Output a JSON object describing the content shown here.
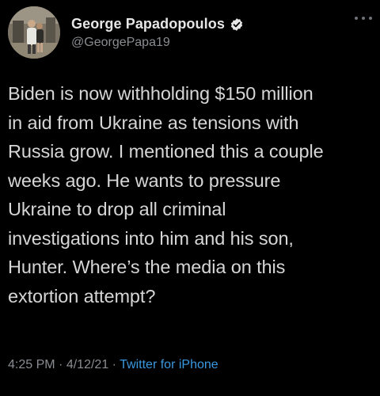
{
  "tweet": {
    "author": {
      "display_name": "George Papadopoulos",
      "handle": "@GeorgePapa19",
      "verified": true,
      "avatar_icon": "user-photo-avatar"
    },
    "more_icon": "more-dots-icon",
    "text": "Biden is now withholding $150 million\nin aid from Ukraine as tensions with\nRussia grow. I mentioned this a couple\nweeks ago. He wants to pressure\nUkraine to drop all criminal\ninvestigations into him and his son,\nHunter. Where’s the media on this\nextortion attempt?",
    "time": "4:25 PM",
    "date": "4/12/21",
    "separator": "·",
    "source": "Twitter for iPhone"
  },
  "colors": {
    "background": "#000000",
    "text": "#d6d6d6",
    "secondary_text": "#8a8d91",
    "link": "#3a98e0",
    "verified_badge": "#e6e6e6"
  }
}
